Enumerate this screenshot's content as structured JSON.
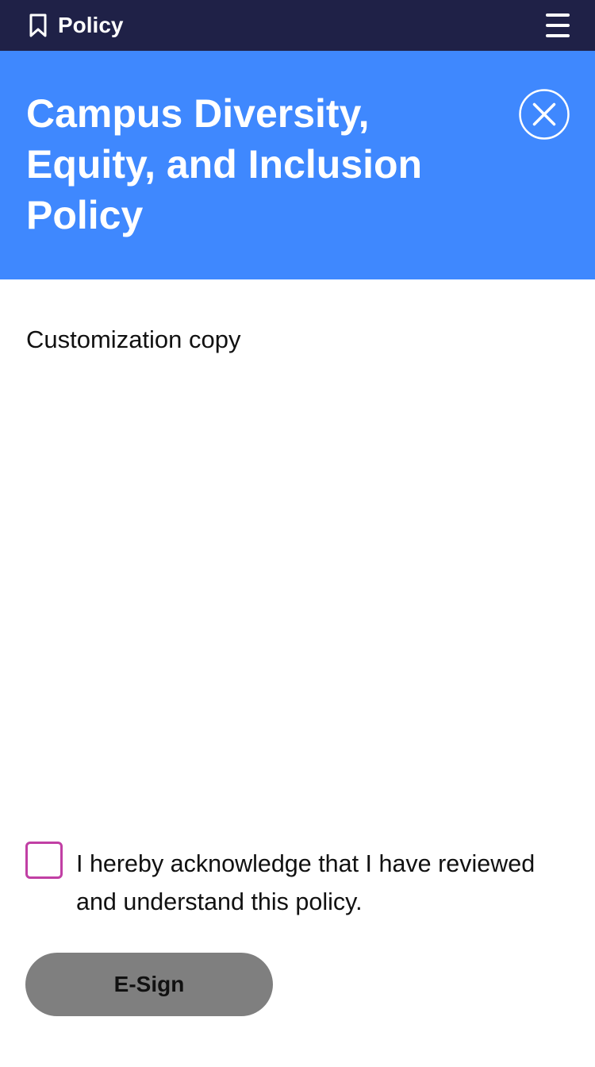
{
  "topbar": {
    "title": "Policy",
    "left_icon": "bookmark-icon",
    "right_icon": "hamburger-menu-icon"
  },
  "hero": {
    "title": "Campus Diversity, Equity, and Inclusion Policy",
    "close_icon": "close-icon"
  },
  "content": {
    "copy": "Customization copy"
  },
  "acknowledgement": {
    "checked": false,
    "text": "I hereby acknowledge that I have reviewed and understand this policy."
  },
  "actions": {
    "esign_label": "E-Sign",
    "esign_enabled": false
  },
  "colors": {
    "topbar": "#1f2147",
    "hero": "#3f88fe",
    "checkbox_border": "#c13fa4",
    "button_disabled": "#7f7f7f"
  }
}
